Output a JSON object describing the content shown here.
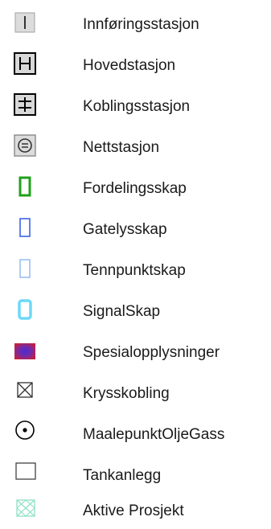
{
  "legend": {
    "items": [
      {
        "label": "Innføringsstasjon",
        "icon": "innforingsstasjon-icon"
      },
      {
        "label": "Hovedstasjon",
        "icon": "hovedstasjon-icon"
      },
      {
        "label": "Koblingsstasjon",
        "icon": "koblingsstasjon-icon"
      },
      {
        "label": "Nettstasjon",
        "icon": "nettstasjon-icon"
      },
      {
        "label": "Fordelingsskap",
        "icon": "fordelingsskap-icon"
      },
      {
        "label": "Gatelysskap",
        "icon": "gatelysskap-icon"
      },
      {
        "label": "Tennpunktskap",
        "icon": "tennpunktskap-icon"
      },
      {
        "label": "SignalSkap",
        "icon": "signalskap-icon"
      },
      {
        "label": "Spesialopplysninger",
        "icon": "spesialopplysninger-icon"
      },
      {
        "label": "Krysskobling",
        "icon": "krysskobling-icon"
      },
      {
        "label": "MaalepunktOljeGass",
        "icon": "maalepunkt-icon"
      },
      {
        "label": "Tankanlegg",
        "icon": "tankanlegg-icon"
      },
      {
        "label": "Aktive Prosjekt",
        "icon": "aktive-prosjekt-icon"
      }
    ],
    "colors": {
      "fordelingsskap": "#22a01c",
      "gatelysskap": "#3c64e6",
      "tennpunktskap": "#78aaf0",
      "signalskap": "#6ed8f8",
      "spesial_center": "#4a2bd6",
      "spesial_edge": "#c81e3c",
      "aktive_prosjekt": "#8ee0c4"
    }
  }
}
